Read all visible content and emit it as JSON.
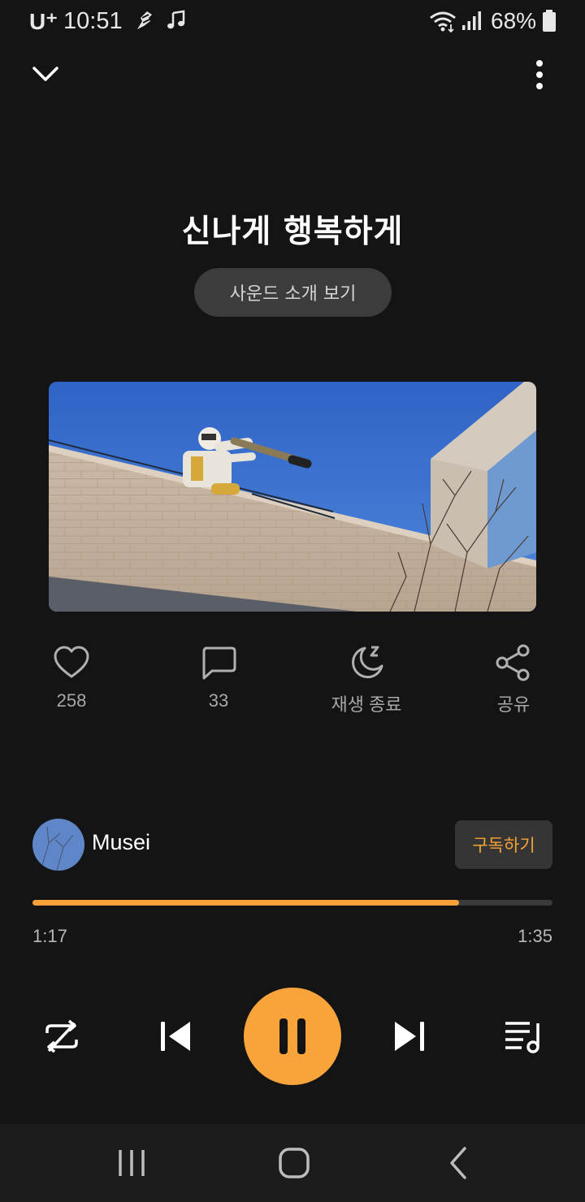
{
  "status_bar": {
    "carrier": "U⁺",
    "time": "10:51",
    "battery": "68%"
  },
  "track": {
    "title": "신나게 행복하게",
    "intro_button": "사운드 소개 보기"
  },
  "actions": {
    "like_count": "258",
    "comment_count": "33",
    "sleep_timer_label": "재생 종료",
    "share_label": "공유"
  },
  "channel": {
    "name": "Musei",
    "subscribe_label": "구독하기"
  },
  "progress": {
    "elapsed": "1:17",
    "total": "1:35",
    "fraction": 0.82
  },
  "colors": {
    "accent": "#f8a43a",
    "background": "#141414"
  }
}
